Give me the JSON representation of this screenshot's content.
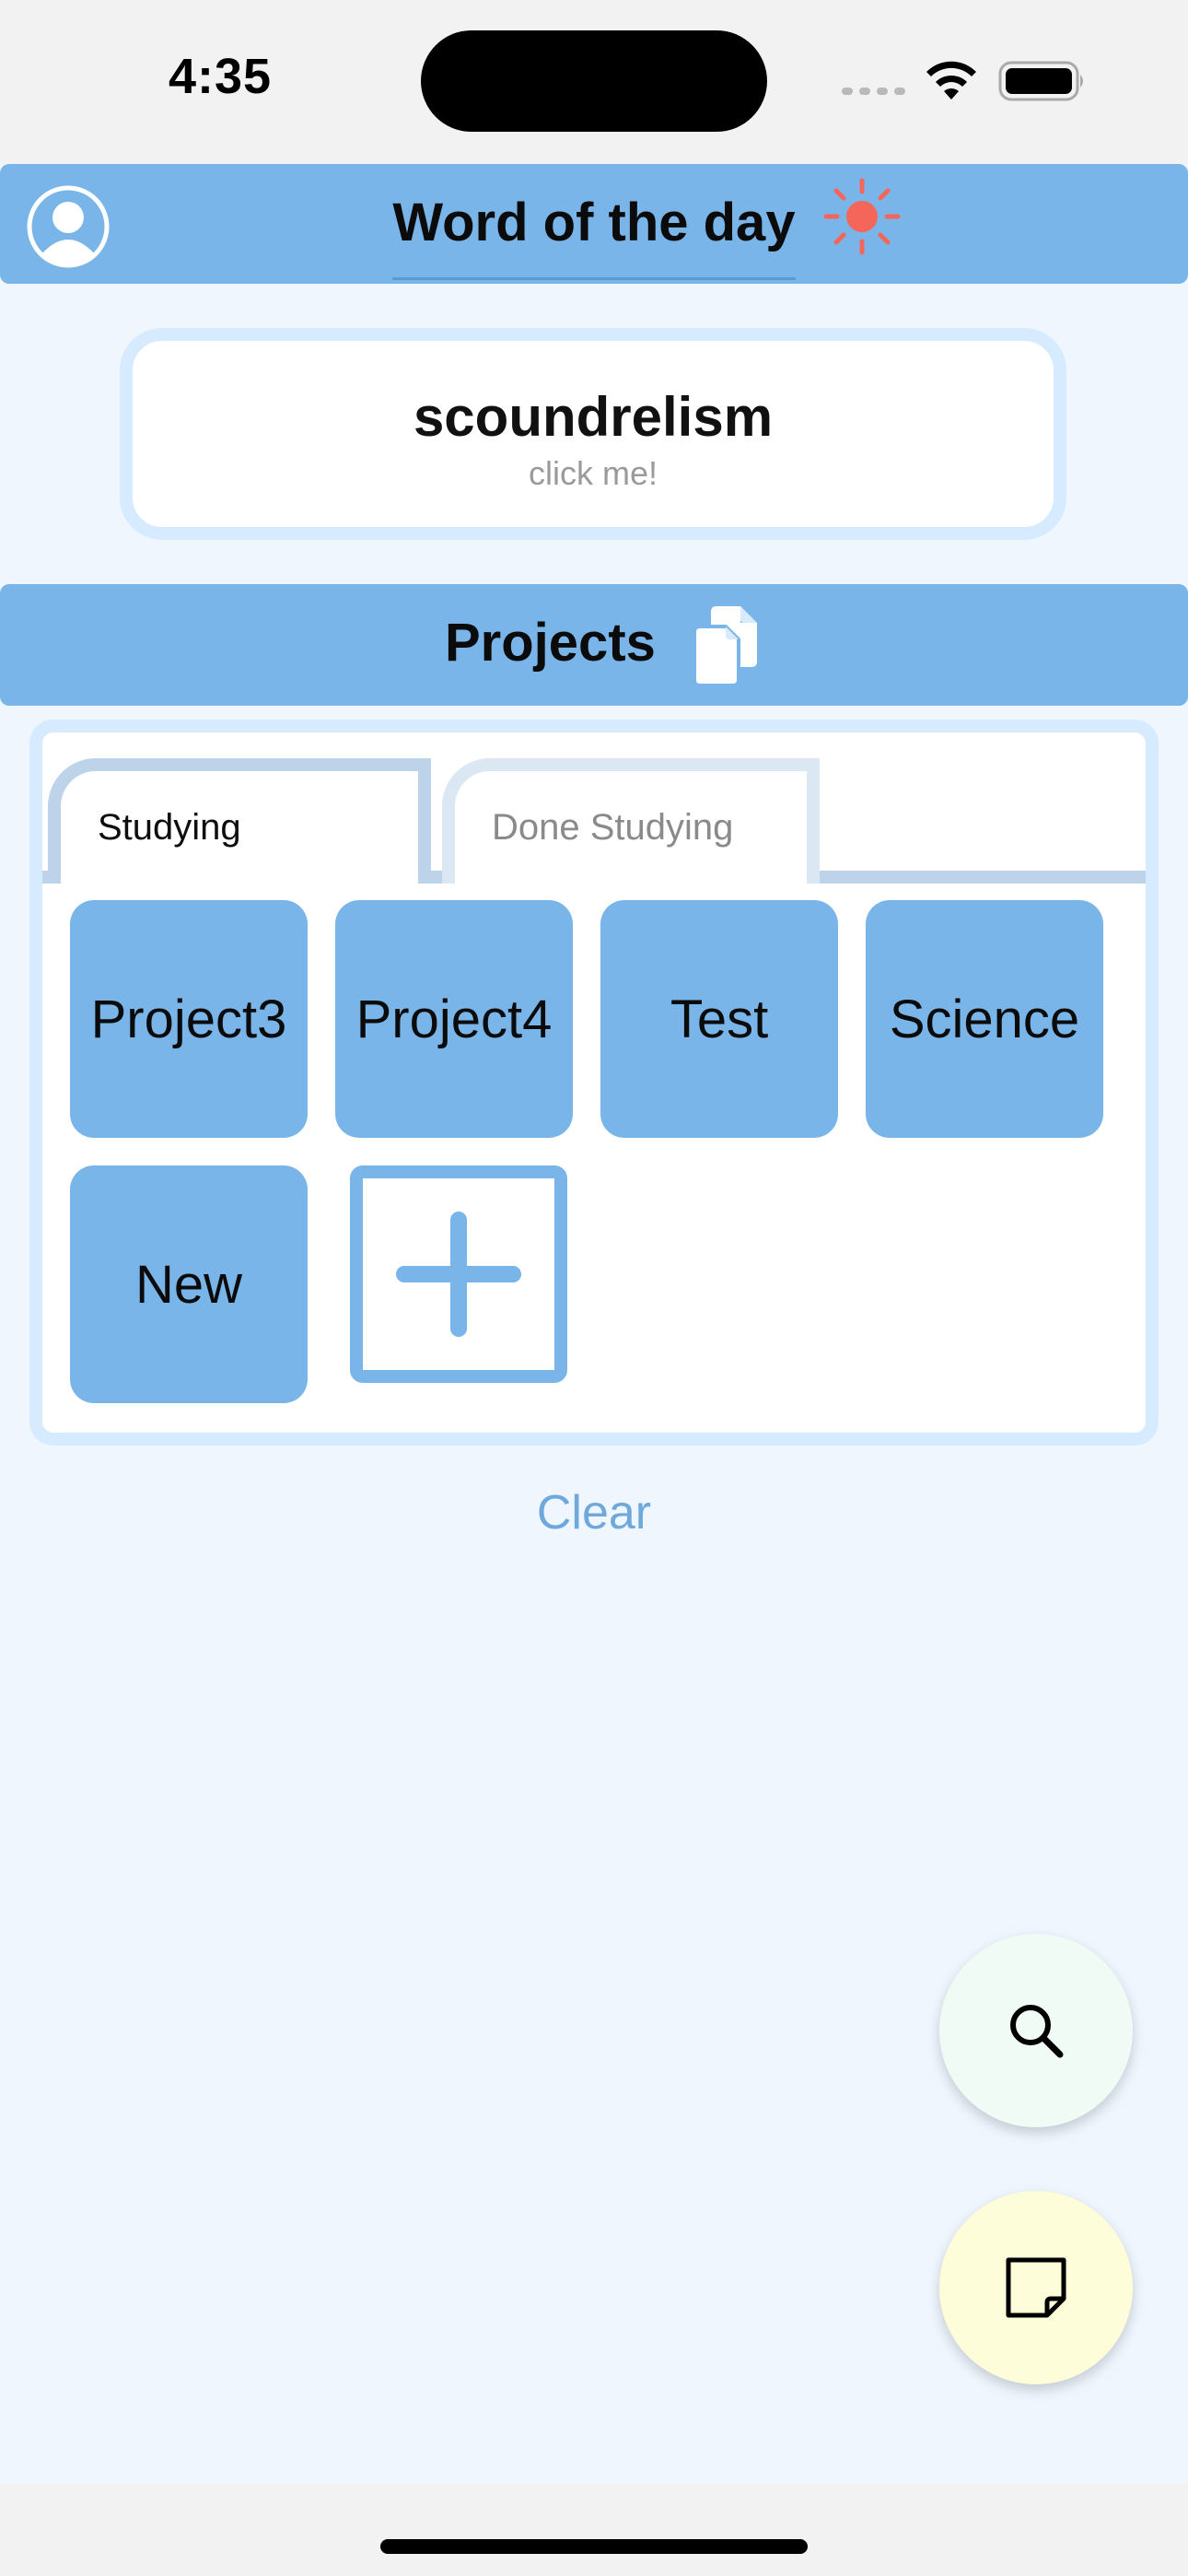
{
  "status_bar": {
    "time": "4:35"
  },
  "header": {
    "title": "Word of the day",
    "avatar_icon": "person-circle-icon",
    "theme_icon": "sun-icon",
    "theme_icon_color": "#f5665a"
  },
  "word_card": {
    "word": "scoundrelism",
    "hint": "click me!"
  },
  "projects": {
    "title": "Projects",
    "icon": "copy-documents-icon",
    "tabs": [
      {
        "label": "Studying",
        "selected": true
      },
      {
        "label": "Done Studying",
        "selected": false
      }
    ],
    "items": [
      {
        "label": "Project3"
      },
      {
        "label": "Project4"
      },
      {
        "label": "Test"
      },
      {
        "label": "Science"
      },
      {
        "label": "New"
      }
    ],
    "add_icon": "plus-icon",
    "clear_label": "Clear"
  },
  "fabs": {
    "search_icon": "search-icon",
    "note_icon": "sticky-note-icon"
  },
  "colors": {
    "accent": "#79b5e8",
    "background": "#eff6fe",
    "card_border": "#d6ebff",
    "clear_link": "#6ea8dc"
  }
}
